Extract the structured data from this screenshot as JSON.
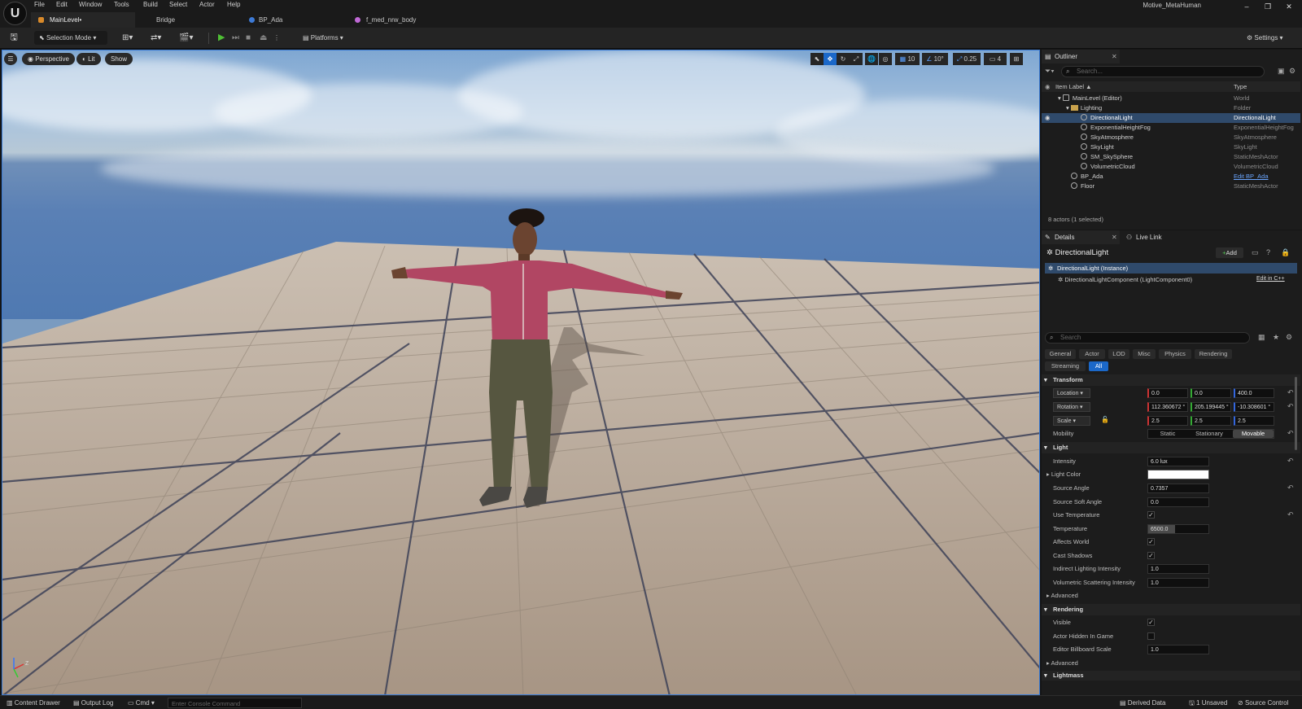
{
  "app": {
    "project": "Motive_MetaHuman"
  },
  "menu": [
    "File",
    "Edit",
    "Window",
    "Tools",
    "Build",
    "Select",
    "Actor",
    "Help"
  ],
  "tabs": [
    {
      "label": "MainLevel•"
    },
    {
      "label": "Bridge"
    },
    {
      "label": "BP_Ada"
    },
    {
      "label": "f_med_nrw_body"
    }
  ],
  "toolbar": {
    "selection_mode": "Selection Mode",
    "platforms": "Platforms",
    "settings": "Settings"
  },
  "viewport": {
    "perspective": "Perspective",
    "lit": "Lit",
    "show": "Show",
    "grid_snap": "10",
    "rot_snap": "10°",
    "scale_snap": "0.25",
    "cam_speed": "4"
  },
  "outliner": {
    "tab": "Outliner",
    "search_placeholder": "Search...",
    "col_label": "Item Label ▲",
    "col_type": "Type",
    "rows": [
      {
        "label": "MainLevel (Editor)",
        "type": "World"
      },
      {
        "label": "Lighting",
        "type": "Folder"
      },
      {
        "label": "DirectionalLight",
        "type": "DirectionalLight"
      },
      {
        "label": "ExponentialHeightFog",
        "type": "ExponentialHeightFog"
      },
      {
        "label": "SkyAtmosphere",
        "type": "SkyAtmosphere"
      },
      {
        "label": "SkyLight",
        "type": "SkyLight"
      },
      {
        "label": "SM_SkySphere",
        "type": "StaticMeshActor"
      },
      {
        "label": "VolumetricCloud",
        "type": "VolumetricCloud"
      },
      {
        "label": "BP_Ada",
        "type": "Edit BP_Ada"
      },
      {
        "label": "Floor",
        "type": "StaticMeshActor"
      }
    ],
    "footer": "8 actors (1 selected)"
  },
  "details": {
    "tab": "Details",
    "tab2": "Live Link",
    "actor": "DirectionalLight",
    "add": "Add",
    "instance": "DirectionalLight (Instance)",
    "component": "DirectionalLightComponent (LightComponent0)",
    "edit_cpp": "Edit in C++",
    "search_placeholder": "Search",
    "cats": [
      "General",
      "Actor",
      "LOD",
      "Misc",
      "Physics",
      "Rendering",
      "Streaming",
      "All"
    ],
    "transform": {
      "title": "Transform",
      "location_label": "Location",
      "location": [
        "0.0",
        "0.0",
        "400.0"
      ],
      "rotation_label": "Rotation",
      "rotation": [
        "112.360672 °",
        "205.199445 °",
        "-10.308601 °"
      ],
      "scale_label": "Scale",
      "scale": [
        "2.5",
        "2.5",
        "2.5"
      ],
      "mobility_label": "Mobility",
      "mobility": [
        "Static",
        "Stationary",
        "Movable"
      ]
    },
    "light": {
      "title": "Light",
      "intensity_label": "Intensity",
      "intensity": "6.0 lux",
      "color_label": "Light Color",
      "source_angle_label": "Source Angle",
      "source_angle": "0.7357",
      "soft_angle_label": "Source Soft Angle",
      "soft_angle": "0.0",
      "use_temp_label": "Use Temperature",
      "temp_label": "Temperature",
      "temp": "6500.0",
      "temp_fill": 0.45,
      "affects_label": "Affects World",
      "cast_label": "Cast Shadows",
      "indirect_label": "Indirect Lighting Intensity",
      "indirect": "1.0",
      "volscatter_label": "Volumetric Scattering Intensity",
      "volscatter": "1.0",
      "advanced": "Advanced"
    },
    "rendering": {
      "title": "Rendering",
      "visible_label": "Visible",
      "hidden_label": "Actor Hidden In Game",
      "billboard_label": "Editor Billboard Scale",
      "billboard": "1.0",
      "advanced": "Advanced"
    },
    "lightmass": "Lightmass"
  },
  "status": {
    "content_drawer": "Content Drawer",
    "output_log": "Output Log",
    "cmd": "Cmd",
    "console_placeholder": "Enter Console Command",
    "derived": "Derived Data",
    "unsaved": "1 Unsaved",
    "source": "Source Control"
  }
}
